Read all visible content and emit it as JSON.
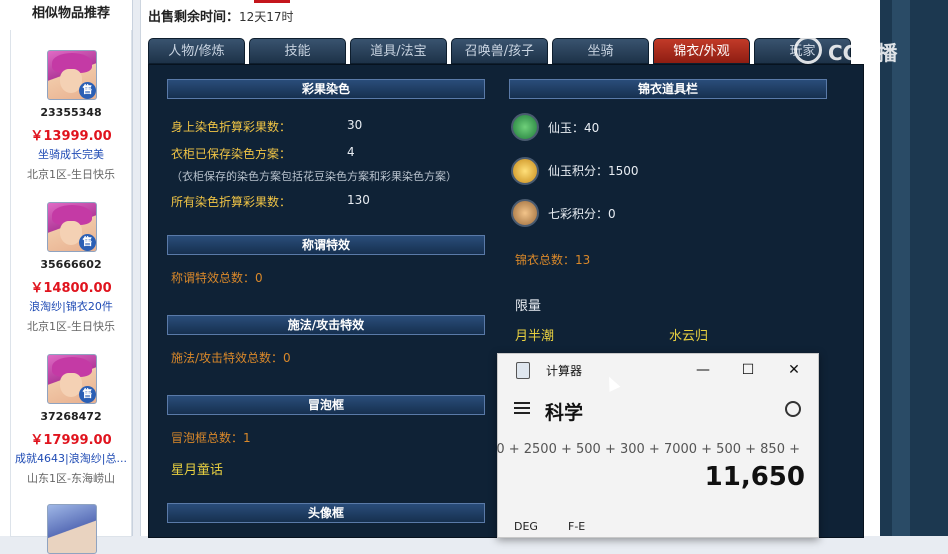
{
  "sidebar": {
    "title": "相似物品推荐",
    "items": [
      {
        "id": "23355348",
        "price": "￥13999.00",
        "desc": "坐骑成长完美",
        "server": "北京1区-生日快乐",
        "badge": "售"
      },
      {
        "id": "35666602",
        "price": "￥14800.00",
        "desc": "浪淘纱|锦衣20件",
        "server": "北京1区-生日快乐",
        "badge": "售"
      },
      {
        "id": "37268472",
        "price": "￥17999.00",
        "desc": "成就4643|浪淘纱|总...",
        "server": "山东1区-东海崂山",
        "badge": "售"
      }
    ]
  },
  "sale": {
    "label": "出售剩余时间：",
    "value": "12天17时"
  },
  "tabs": [
    "人物/修炼",
    "技能",
    "道具/法宝",
    "召唤兽/孩子",
    "坐骑",
    "锦衣/外观",
    "玩家"
  ],
  "active_tab_index": 5,
  "left": {
    "sections": {
      "dye": "彩果染色",
      "title": "称谓特效",
      "spell": "施法/攻击特效",
      "bubble": "冒泡框",
      "avatar": "头像框"
    },
    "dye_rows": [
      {
        "label": "身上染色折算彩果数：",
        "value": "30"
      },
      {
        "label": "衣柜已保存染色方案：",
        "value": "4"
      },
      {
        "label": "所有染色折算彩果数：",
        "value": "130"
      }
    ],
    "dye_note": "（衣柜保存的染色方案包括花豆染色方案和彩果染色方案）",
    "title_total": "称谓特效总数：0",
    "spell_total": "施法/攻击特效总数：0",
    "bubble_total": "冒泡框总数：1",
    "bubble_item": "星月童话"
  },
  "right": {
    "section": "锦衣道具栏",
    "currencies": [
      {
        "icon": "jade-icon",
        "text": "仙玉：40"
      },
      {
        "icon": "jade-points-icon",
        "text": "仙玉积分：1500"
      },
      {
        "icon": "rainbow-points-icon",
        "text": "七彩积分：0"
      }
    ],
    "total": "锦衣总数：13",
    "limited_label": "限量",
    "items": [
      "月半潮",
      "水云归"
    ]
  },
  "calculator": {
    "title": "计算器",
    "mode": "科学",
    "expression": "0 + 2500 + 500 + 300 + 7000 + 500 + 850 +",
    "result": "11,650",
    "deg": "DEG",
    "fe": "F-E",
    "buttons": {
      "minimize": "—",
      "maximize": "☐",
      "close": "✕"
    }
  },
  "watermark": "CC直播",
  "colors": {
    "active_tab": "#c23a28",
    "panel": "#0f2236",
    "price": "#e0141e",
    "gold": "#f0c445"
  }
}
